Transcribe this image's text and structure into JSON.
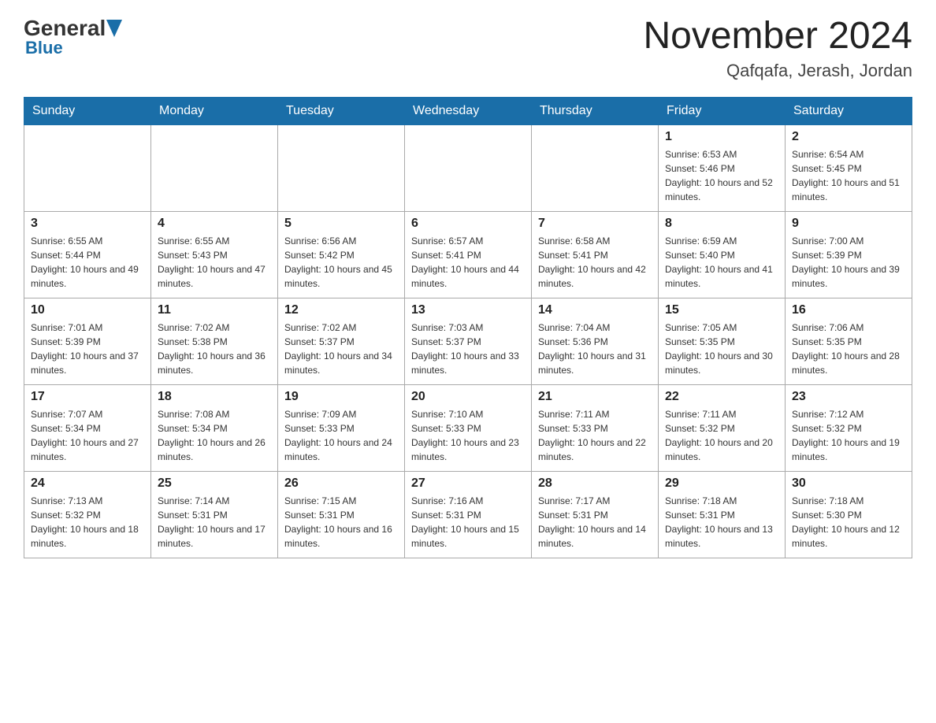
{
  "logo": {
    "general": "General",
    "blue": "Blue"
  },
  "title": {
    "month_year": "November 2024",
    "location": "Qafqafa, Jerash, Jordan"
  },
  "weekdays": [
    "Sunday",
    "Monday",
    "Tuesday",
    "Wednesday",
    "Thursday",
    "Friday",
    "Saturday"
  ],
  "weeks": [
    [
      {
        "day": "",
        "sunrise": "",
        "sunset": "",
        "daylight": ""
      },
      {
        "day": "",
        "sunrise": "",
        "sunset": "",
        "daylight": ""
      },
      {
        "day": "",
        "sunrise": "",
        "sunset": "",
        "daylight": ""
      },
      {
        "day": "",
        "sunrise": "",
        "sunset": "",
        "daylight": ""
      },
      {
        "day": "",
        "sunrise": "",
        "sunset": "",
        "daylight": ""
      },
      {
        "day": "1",
        "sunrise": "Sunrise: 6:53 AM",
        "sunset": "Sunset: 5:46 PM",
        "daylight": "Daylight: 10 hours and 52 minutes."
      },
      {
        "day": "2",
        "sunrise": "Sunrise: 6:54 AM",
        "sunset": "Sunset: 5:45 PM",
        "daylight": "Daylight: 10 hours and 51 minutes."
      }
    ],
    [
      {
        "day": "3",
        "sunrise": "Sunrise: 6:55 AM",
        "sunset": "Sunset: 5:44 PM",
        "daylight": "Daylight: 10 hours and 49 minutes."
      },
      {
        "day": "4",
        "sunrise": "Sunrise: 6:55 AM",
        "sunset": "Sunset: 5:43 PM",
        "daylight": "Daylight: 10 hours and 47 minutes."
      },
      {
        "day": "5",
        "sunrise": "Sunrise: 6:56 AM",
        "sunset": "Sunset: 5:42 PM",
        "daylight": "Daylight: 10 hours and 45 minutes."
      },
      {
        "day": "6",
        "sunrise": "Sunrise: 6:57 AM",
        "sunset": "Sunset: 5:41 PM",
        "daylight": "Daylight: 10 hours and 44 minutes."
      },
      {
        "day": "7",
        "sunrise": "Sunrise: 6:58 AM",
        "sunset": "Sunset: 5:41 PM",
        "daylight": "Daylight: 10 hours and 42 minutes."
      },
      {
        "day": "8",
        "sunrise": "Sunrise: 6:59 AM",
        "sunset": "Sunset: 5:40 PM",
        "daylight": "Daylight: 10 hours and 41 minutes."
      },
      {
        "day": "9",
        "sunrise": "Sunrise: 7:00 AM",
        "sunset": "Sunset: 5:39 PM",
        "daylight": "Daylight: 10 hours and 39 minutes."
      }
    ],
    [
      {
        "day": "10",
        "sunrise": "Sunrise: 7:01 AM",
        "sunset": "Sunset: 5:39 PM",
        "daylight": "Daylight: 10 hours and 37 minutes."
      },
      {
        "day": "11",
        "sunrise": "Sunrise: 7:02 AM",
        "sunset": "Sunset: 5:38 PM",
        "daylight": "Daylight: 10 hours and 36 minutes."
      },
      {
        "day": "12",
        "sunrise": "Sunrise: 7:02 AM",
        "sunset": "Sunset: 5:37 PM",
        "daylight": "Daylight: 10 hours and 34 minutes."
      },
      {
        "day": "13",
        "sunrise": "Sunrise: 7:03 AM",
        "sunset": "Sunset: 5:37 PM",
        "daylight": "Daylight: 10 hours and 33 minutes."
      },
      {
        "day": "14",
        "sunrise": "Sunrise: 7:04 AM",
        "sunset": "Sunset: 5:36 PM",
        "daylight": "Daylight: 10 hours and 31 minutes."
      },
      {
        "day": "15",
        "sunrise": "Sunrise: 7:05 AM",
        "sunset": "Sunset: 5:35 PM",
        "daylight": "Daylight: 10 hours and 30 minutes."
      },
      {
        "day": "16",
        "sunrise": "Sunrise: 7:06 AM",
        "sunset": "Sunset: 5:35 PM",
        "daylight": "Daylight: 10 hours and 28 minutes."
      }
    ],
    [
      {
        "day": "17",
        "sunrise": "Sunrise: 7:07 AM",
        "sunset": "Sunset: 5:34 PM",
        "daylight": "Daylight: 10 hours and 27 minutes."
      },
      {
        "day": "18",
        "sunrise": "Sunrise: 7:08 AM",
        "sunset": "Sunset: 5:34 PM",
        "daylight": "Daylight: 10 hours and 26 minutes."
      },
      {
        "day": "19",
        "sunrise": "Sunrise: 7:09 AM",
        "sunset": "Sunset: 5:33 PM",
        "daylight": "Daylight: 10 hours and 24 minutes."
      },
      {
        "day": "20",
        "sunrise": "Sunrise: 7:10 AM",
        "sunset": "Sunset: 5:33 PM",
        "daylight": "Daylight: 10 hours and 23 minutes."
      },
      {
        "day": "21",
        "sunrise": "Sunrise: 7:11 AM",
        "sunset": "Sunset: 5:33 PM",
        "daylight": "Daylight: 10 hours and 22 minutes."
      },
      {
        "day": "22",
        "sunrise": "Sunrise: 7:11 AM",
        "sunset": "Sunset: 5:32 PM",
        "daylight": "Daylight: 10 hours and 20 minutes."
      },
      {
        "day": "23",
        "sunrise": "Sunrise: 7:12 AM",
        "sunset": "Sunset: 5:32 PM",
        "daylight": "Daylight: 10 hours and 19 minutes."
      }
    ],
    [
      {
        "day": "24",
        "sunrise": "Sunrise: 7:13 AM",
        "sunset": "Sunset: 5:32 PM",
        "daylight": "Daylight: 10 hours and 18 minutes."
      },
      {
        "day": "25",
        "sunrise": "Sunrise: 7:14 AM",
        "sunset": "Sunset: 5:31 PM",
        "daylight": "Daylight: 10 hours and 17 minutes."
      },
      {
        "day": "26",
        "sunrise": "Sunrise: 7:15 AM",
        "sunset": "Sunset: 5:31 PM",
        "daylight": "Daylight: 10 hours and 16 minutes."
      },
      {
        "day": "27",
        "sunrise": "Sunrise: 7:16 AM",
        "sunset": "Sunset: 5:31 PM",
        "daylight": "Daylight: 10 hours and 15 minutes."
      },
      {
        "day": "28",
        "sunrise": "Sunrise: 7:17 AM",
        "sunset": "Sunset: 5:31 PM",
        "daylight": "Daylight: 10 hours and 14 minutes."
      },
      {
        "day": "29",
        "sunrise": "Sunrise: 7:18 AM",
        "sunset": "Sunset: 5:31 PM",
        "daylight": "Daylight: 10 hours and 13 minutes."
      },
      {
        "day": "30",
        "sunrise": "Sunrise: 7:18 AM",
        "sunset": "Sunset: 5:30 PM",
        "daylight": "Daylight: 10 hours and 12 minutes."
      }
    ]
  ]
}
